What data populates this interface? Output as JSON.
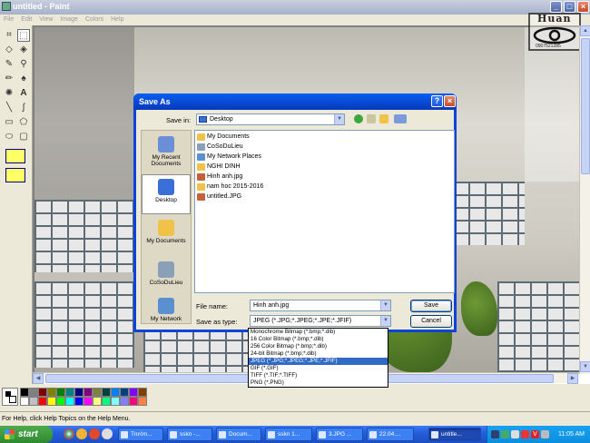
{
  "app": {
    "title": "untitled - Paint",
    "menu": [
      "File",
      "Edit",
      "View",
      "Image",
      "Colors",
      "Help"
    ],
    "status": "For Help, click Help Topics on the Help Menu."
  },
  "palette_colors": [
    "#000000",
    "#808080",
    "#800000",
    "#808000",
    "#008000",
    "#008080",
    "#000080",
    "#800080",
    "#808040",
    "#004040",
    "#0080ff",
    "#004080",
    "#8000ff",
    "#804000",
    "#ffffff",
    "#c0c0c0",
    "#ff0000",
    "#ffff00",
    "#00ff00",
    "#00ffff",
    "#0000ff",
    "#ff00ff",
    "#ffff80",
    "#00ff80",
    "#80ffff",
    "#8080ff",
    "#ff0080",
    "#ff8040"
  ],
  "logo": {
    "text": "Huan",
    "number": "0907521285"
  },
  "dialog": {
    "title": "Save As",
    "save_in_label": "Save in:",
    "save_in_value": "Desktop",
    "places": [
      "My Recent Documents",
      "Desktop",
      "My Documents",
      "CoSoDuLieu",
      "My Network"
    ],
    "files": [
      "My Documents",
      "CoSoDuLieu",
      "My Network Places",
      "NGHI DINH",
      "Hinh anh.jpg",
      "nam hoc 2015-2016",
      "untitled.JPG"
    ],
    "filename_label": "File name:",
    "filename_value": "Hinh anh.jpg",
    "type_label": "Save as type:",
    "type_value": "JPEG (*.JPG;*.JPEG;*.JPE;*.JFIF)",
    "save_label": "Save",
    "cancel_label": "Cancel",
    "type_options": [
      "Monochrome Bitmap (*.bmp;*.dib)",
      "16 Color Bitmap (*.bmp;*.dib)",
      "256 Color Bitmap (*.bmp;*.dib)",
      "24-bit Bitmap (*.bmp;*.dib)",
      "JPEG (*.JPG;*.JPEG;*.JPE;*.JFIF)",
      "GIF (*.GIF)",
      "TIFF (*.TIF;*.TIFF)",
      "PNG (*.PNG)"
    ]
  },
  "taskbar": {
    "start": "start",
    "tasks": [
      "Trườn...",
      "sskn -...",
      "Docum...",
      "sskn 1...",
      "3.JPG ...",
      "22.04....",
      "untitle..."
    ],
    "clock": "11:05 AM"
  }
}
